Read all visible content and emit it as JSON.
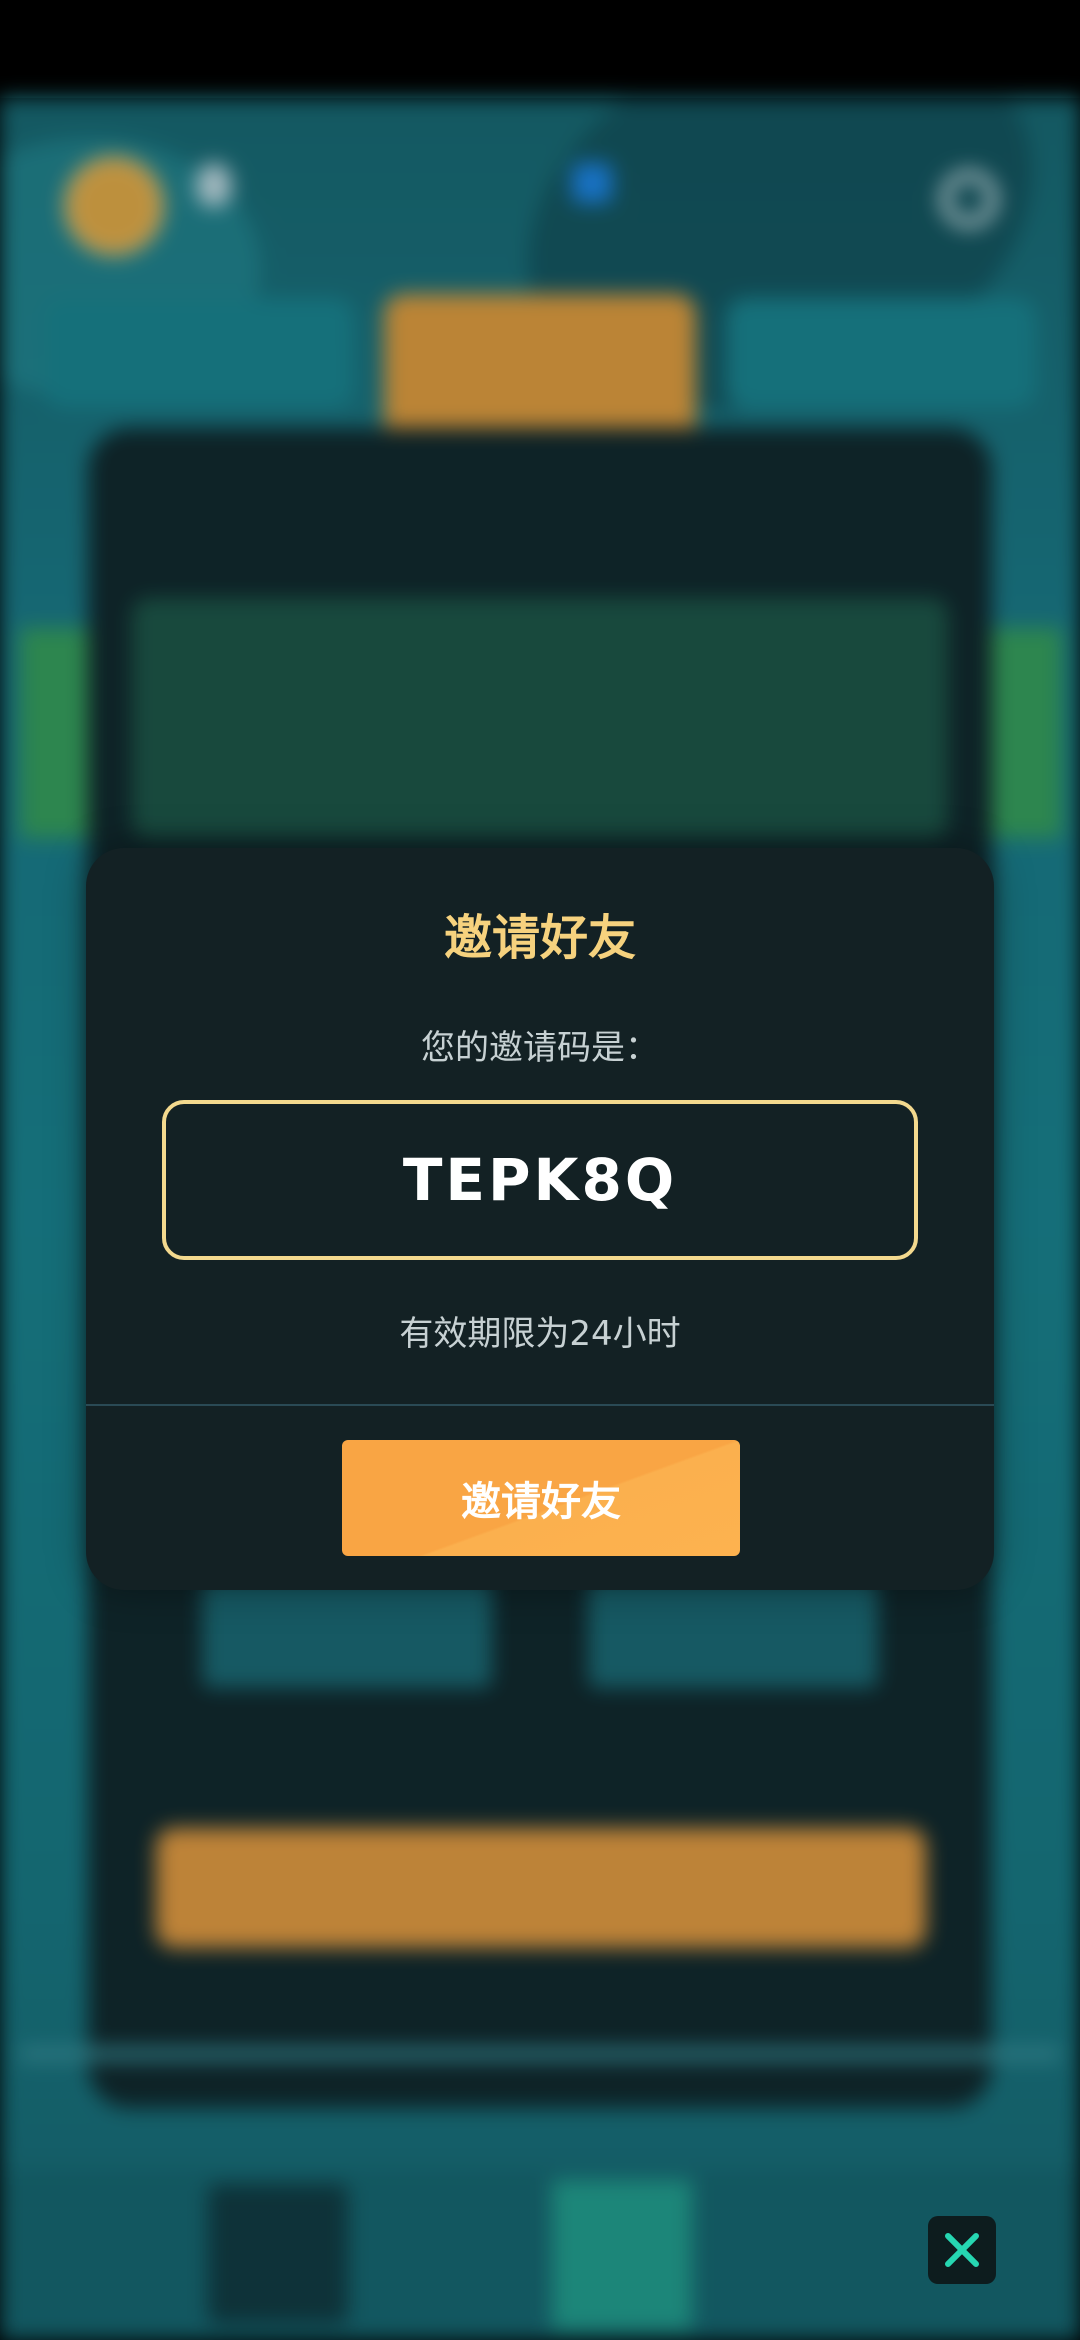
{
  "dialog": {
    "title": "邀请好友",
    "subtitle": "您的邀请码是：",
    "invite_code": "TEPK8Q",
    "validity": "有效期限为24小时",
    "button_label": "邀请好友"
  },
  "floating": {
    "close_icon": "close-icon"
  },
  "colors": {
    "title": "#f6d27e",
    "button": "#f9a544",
    "code_border": "#f3d98e",
    "dialog_bg": "#132124",
    "close_x": "#26d7b2"
  }
}
